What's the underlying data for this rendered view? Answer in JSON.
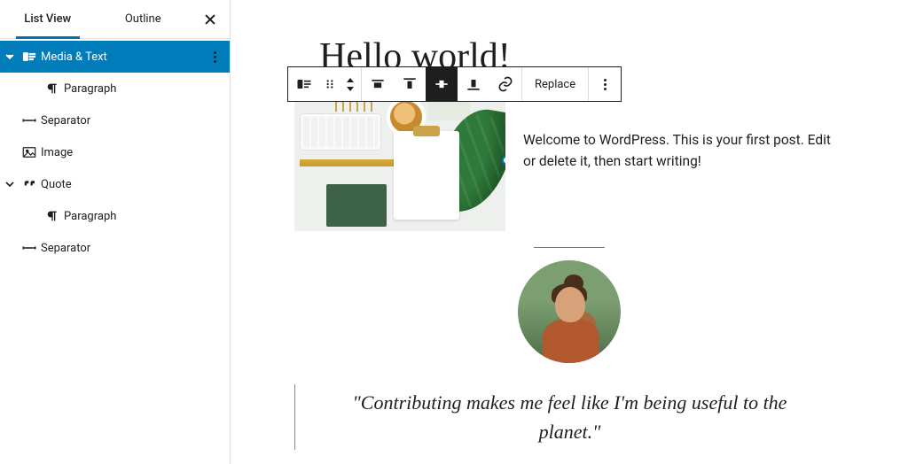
{
  "sidebar": {
    "tabs": {
      "list_view": "List View",
      "outline": "Outline"
    },
    "items": [
      {
        "label": "Media & Text",
        "icon": "media-text-icon",
        "expandable": true,
        "selected": true,
        "depth": 0
      },
      {
        "label": "Paragraph",
        "icon": "paragraph-icon",
        "expandable": false,
        "selected": false,
        "depth": 1
      },
      {
        "label": "Separator",
        "icon": "separator-icon",
        "expandable": false,
        "selected": false,
        "depth": 0
      },
      {
        "label": "Image",
        "icon": "image-icon",
        "expandable": false,
        "selected": false,
        "depth": 0
      },
      {
        "label": "Quote",
        "icon": "quote-icon",
        "expandable": true,
        "selected": false,
        "depth": 0
      },
      {
        "label": "Paragraph",
        "icon": "paragraph-icon",
        "expandable": false,
        "selected": false,
        "depth": 1
      },
      {
        "label": "Separator",
        "icon": "separator-icon",
        "expandable": false,
        "selected": false,
        "depth": 0
      }
    ]
  },
  "toolbar": {
    "replace_label": "Replace",
    "buttons": [
      {
        "name": "block-type-media-text",
        "active": false
      },
      {
        "name": "drag-handle",
        "active": false
      },
      {
        "name": "move-up-down",
        "active": false
      },
      {
        "name": "align-none",
        "active": false
      },
      {
        "name": "vertical-align-top",
        "active": false
      },
      {
        "name": "vertical-align-middle",
        "active": true
      },
      {
        "name": "vertical-align-bottom",
        "active": false
      },
      {
        "name": "link",
        "active": false
      }
    ]
  },
  "page": {
    "title": "Hello world!",
    "media_text_paragraph": "Welcome to WordPress. This is your first post. Edit or delete it, then start writing!",
    "quote": "\"Contributing makes me feel like I'm being useful to the planet.\""
  },
  "colors": {
    "accent": "#007cba"
  }
}
